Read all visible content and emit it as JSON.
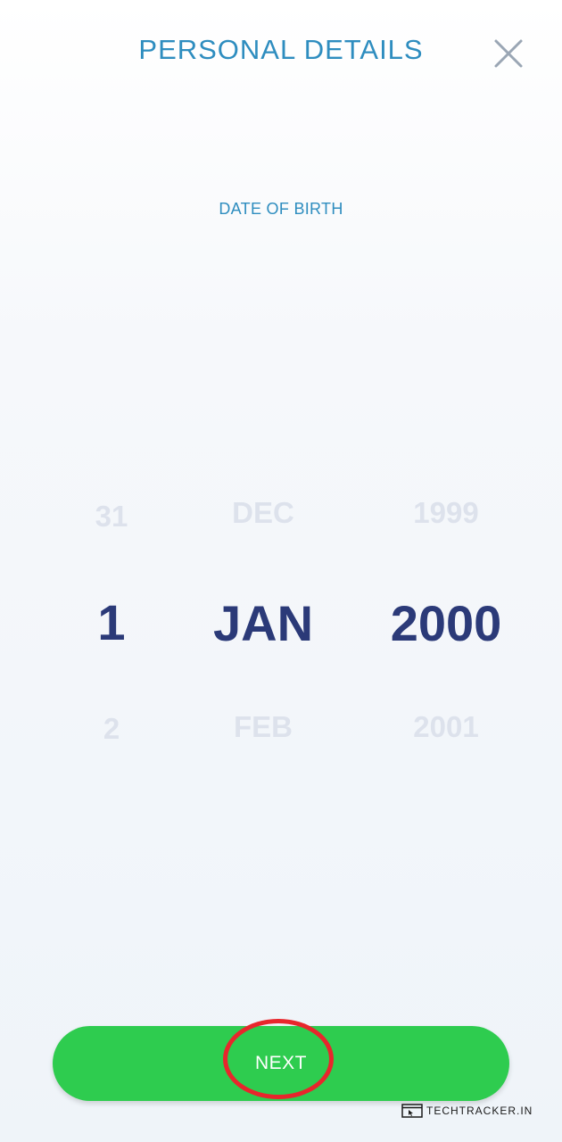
{
  "header": {
    "title": "PERSONAL DETAILS",
    "close_icon": "close-icon"
  },
  "date_of_birth": {
    "label": "DATE OF BIRTH",
    "day": {
      "prev": "31",
      "selected": "1",
      "next": "2"
    },
    "month": {
      "prev": "DEC",
      "selected": "JAN",
      "next": "FEB"
    },
    "year": {
      "prev": "1999",
      "selected": "2000",
      "next": "2001"
    }
  },
  "actions": {
    "next_label": "NEXT"
  },
  "watermark": {
    "text": "TECHTRACKER.IN",
    "icon": "browser-cursor-icon"
  },
  "colors": {
    "accent": "#2e8dbf",
    "selected_text": "#2b3a78",
    "dim_text": "#dde2ec",
    "button": "#2ecc4f",
    "highlight_ring": "#e8262c"
  }
}
